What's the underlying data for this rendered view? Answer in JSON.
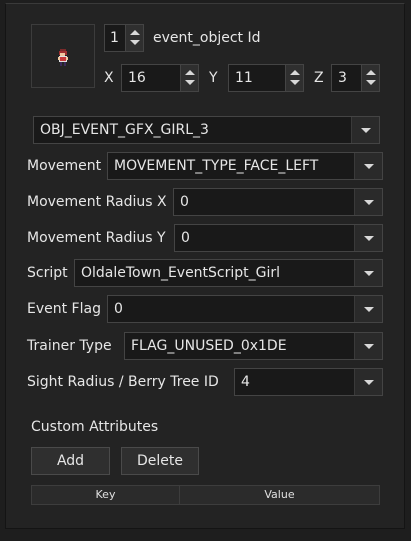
{
  "object": {
    "sprite_name": "girl-sprite",
    "index": "1",
    "id_label": "event_object Id",
    "x_label": "X",
    "x_value": "16",
    "y_label": "Y",
    "y_value": "11",
    "z_label": "Z",
    "z_value": "3"
  },
  "fields": {
    "gfx": "OBJ_EVENT_GFX_GIRL_3",
    "movement_label": "Movement",
    "movement": "MOVEMENT_TYPE_FACE_LEFT",
    "radius_x_label": "Movement Radius X",
    "radius_x": "0",
    "radius_y_label": "Movement Radius Y",
    "radius_y": "0",
    "script_label": "Script",
    "script": "OldaleTown_EventScript_Girl",
    "flag_label": "Event Flag",
    "flag": "0",
    "trainer_label": "Trainer Type",
    "trainer": "FLAG_UNUSED_0x1DE",
    "sight_label": "Sight Radius / Berry Tree ID",
    "sight": "4"
  },
  "custom": {
    "title": "Custom Attributes",
    "add_label": "Add",
    "delete_label": "Delete",
    "columns": [
      "Key",
      "Value"
    ]
  },
  "colors": {
    "background": "#1e1e1e",
    "panel": "#232323",
    "field": "#191919",
    "text": "#e6e6e6"
  }
}
